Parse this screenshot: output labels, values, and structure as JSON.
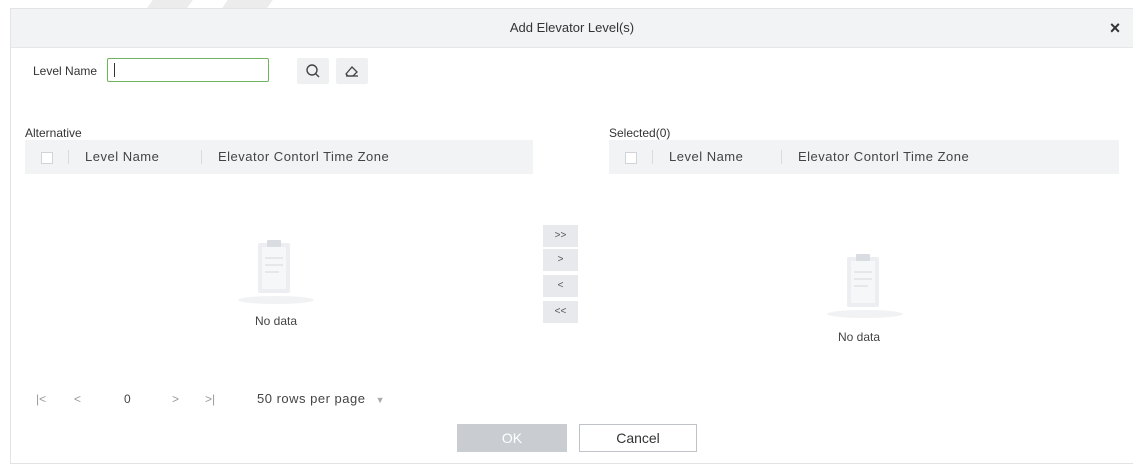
{
  "dialog": {
    "title": "Add Elevator Level(s)"
  },
  "search": {
    "label": "Level Name",
    "value": ""
  },
  "alternative": {
    "heading": "Alternative",
    "columns": [
      "Level Name",
      "Elevator Contorl Time Zone"
    ],
    "empty_text": "No data"
  },
  "selected": {
    "heading": "Selected(0)",
    "columns": [
      "Level Name",
      "Elevator Contorl Time Zone"
    ],
    "empty_text": "No data"
  },
  "transfer": {
    "all_right": ">>",
    "right": ">",
    "left": "<",
    "all_left": "<<"
  },
  "pager": {
    "first": "|<",
    "prev": "<",
    "page": "0",
    "next": ">",
    "last": ">|",
    "rows_per_page": "50 rows per page"
  },
  "buttons": {
    "ok": "OK",
    "cancel": "Cancel"
  },
  "colors": {
    "ok_button": "#c9cdd2",
    "input_border": "#6db45c",
    "header_bg": "#f1f3f5"
  }
}
